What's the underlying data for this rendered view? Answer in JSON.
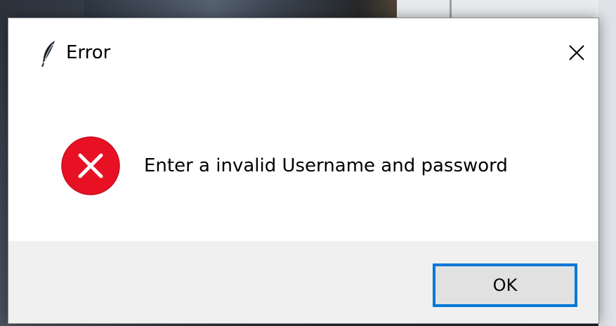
{
  "dialog": {
    "title": "Error",
    "message": "Enter a invalid Username and password",
    "ok_label": "OK",
    "app_icon": "feather-icon",
    "close_icon": "close-icon",
    "status_icon": "error-icon"
  },
  "colors": {
    "error_red": "#e81123",
    "focus_blue": "#0078d7",
    "footer_bg": "#f0f0f0",
    "button_bg": "#e1e1e1"
  }
}
